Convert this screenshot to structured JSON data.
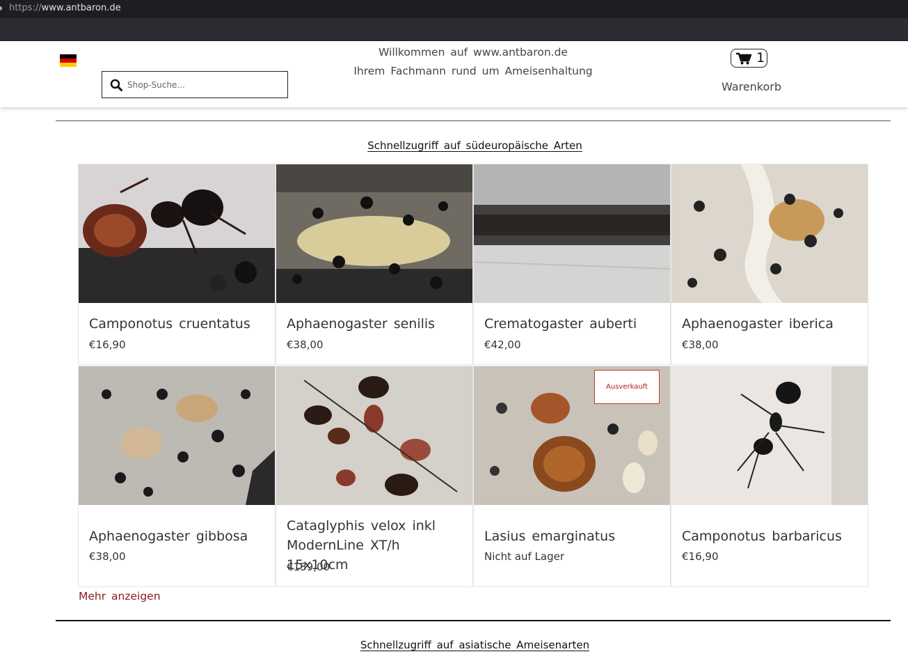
{
  "browser": {
    "scheme": "https://",
    "host": "www.antbaron.de"
  },
  "header": {
    "welcome_line1": "Willkommen auf www.antbaron.de",
    "welcome_line2": "Ihrem Fachmann rund um Ameisenhaltung",
    "search_placeholder": "Shop-Suche...",
    "cart_count": "1",
    "cart_label": "Warenkorb",
    "flag_colors": [
      "#000000",
      "#DD0000",
      "#FFCE00"
    ]
  },
  "section1": {
    "title": "Schnellzugriff auf südeuropäische Arten",
    "products": [
      {
        "name": "Camponotus cruentatus",
        "price": "€16,90",
        "image": "ant-camponotus-cruentatus"
      },
      {
        "name": "Aphaenogaster senilis",
        "price": "€38,00",
        "image": "ant-aphaenogaster-senilis"
      },
      {
        "name": "Crematogaster auberti",
        "price": "€42,00",
        "image": "ant-crematogaster-auberti"
      },
      {
        "name": "Aphaenogaster iberica",
        "price": "€38,00",
        "image": "ant-aphaenogaster-iberica"
      },
      {
        "name": "Aphaenogaster gibbosa",
        "price": "€38,00",
        "image": "ant-aphaenogaster-gibbosa"
      },
      {
        "name": "Cataglyphis velox inkl ModernLine XT/h 15x10cm",
        "price": "€139,00",
        "image": "ant-cataglyphis-velox"
      },
      {
        "name": "Lasius emarginatus",
        "price": "Nicht auf Lager",
        "badge": "Ausverkauft",
        "image": "ant-lasius-emarginatus"
      },
      {
        "name": "Camponotus barbaricus",
        "price": "€16,90",
        "image": "ant-camponotus-barbaricus"
      }
    ],
    "more_label": "Mehr anzeigen"
  },
  "section2": {
    "title": "Schnellzugriff auf asiatische Ameisenarten"
  },
  "colors": {
    "accent_link": "#8b1a1a",
    "badge_red": "#b71c1c",
    "chrome_dark": "#1e1e22"
  }
}
